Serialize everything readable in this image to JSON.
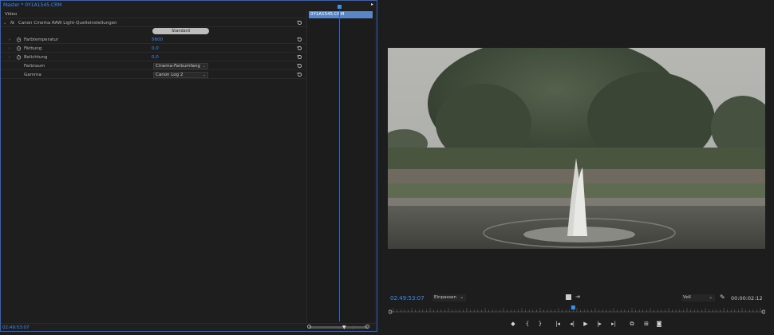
{
  "left_panel": {
    "tab_title": "Master * 0Y1A1545.CRM",
    "section_video": "Video",
    "effect_name": "Canon Cinema RAW Light-Quelleinstellungen",
    "standard_button": "Standard",
    "properties": [
      {
        "label": "Farbtemperatur",
        "value": "5600"
      },
      {
        "label": "Färbung",
        "value": "0,0"
      },
      {
        "label": "Belichtung",
        "value": "0,0"
      }
    ],
    "dropdowns": [
      {
        "label": "Farbraum",
        "value": "Cinema-Farbumfang"
      },
      {
        "label": "Gamma",
        "value": "Canon Log 2"
      }
    ],
    "current_time": "02:49:53:07"
  },
  "mini_timeline": {
    "clip_name": "0Y1A1545.CRM"
  },
  "program_monitor": {
    "timecode": "02:49:53:07",
    "fit_select": "Einpassen",
    "quality_select": "Voll",
    "duration": "00:00:02:12",
    "playhead_fraction": 0.49
  },
  "colors": {
    "accent": "#3a8ef0",
    "panel_border": "#2d62d0"
  }
}
